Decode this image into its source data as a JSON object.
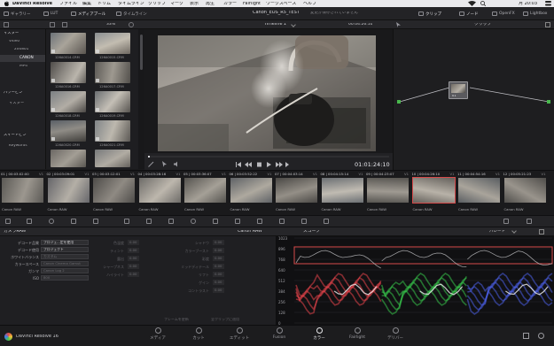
{
  "menubar": {
    "app": "DaVinci Resolve",
    "items": [
      "ファイル",
      "編集",
      "トリム",
      "タイムライン",
      "クリップ",
      "マーク",
      "表示",
      "再生",
      "カラー",
      "Fairlight",
      "ワークスペース",
      "ヘルプ"
    ],
    "clock": "月 20:03"
  },
  "toolbar": {
    "gallery": "ギャラリー",
    "lut": "LUT",
    "media_pool": "メディアプール",
    "timelines": "タイムライン",
    "project_title": "Canon_EOS_R5_TEST",
    "project_status": "変更が保存されていません",
    "clips": "クリップ",
    "nodes": "ノード",
    "openfx": "OpenFX",
    "lightbox": "Lightbox"
  },
  "media_pool": {
    "zoom": "33%",
    "bins": [
      {
        "label": "マスター",
        "selected": false
      },
      {
        "label": "Video",
        "selected": false
      },
      {
        "label": "200801",
        "selected": false
      },
      {
        "label": "CANON",
        "selected": true
      },
      {
        "label": "MP4",
        "selected": false
      }
    ],
    "power_bins_header": "パワービン",
    "power_bins": [
      "マスター"
    ],
    "smart_bins_header": "スマートビン",
    "smart_bins": [
      "Keywords"
    ],
    "clips": [
      "126A0014.CRM",
      "126A0015.CRM",
      "126A0016.CRM",
      "126A0017.CRM",
      "126A0018.CRM",
      "126A0019.CRM",
      "126A0020.CRM",
      "126A0021.CRM",
      "126A0022.CRM",
      "126A0023.CRM"
    ]
  },
  "viewer": {
    "timeline_name": "Timeline 1",
    "timecode": "01:01:24:10",
    "header_timecode": "00:04:26:10"
  },
  "node_editor": {
    "label": "クリップ",
    "node_label": "01"
  },
  "clip_strip": {
    "clips": [
      {
        "num": "01",
        "tc": "00:03:02:00",
        "track": "V1",
        "cap": "Canon RAW"
      },
      {
        "num": "02",
        "tc": "00:03:09:01",
        "track": "V1",
        "cap": "Canon RAW"
      },
      {
        "num": "03",
        "tc": "00:03:12:01",
        "track": "V1",
        "cap": "Canon RAW"
      },
      {
        "num": "04",
        "tc": "00:03:28:16",
        "track": "V1",
        "cap": "Canon RAW"
      },
      {
        "num": "05",
        "tc": "00:03:36:07",
        "track": "V1",
        "cap": "Canon RAW"
      },
      {
        "num": "06",
        "tc": "00:03:52:22",
        "track": "V1",
        "cap": "Canon RAW"
      },
      {
        "num": "07",
        "tc": "00:04:03:14",
        "track": "V1",
        "cap": "Canon RAW"
      },
      {
        "num": "08",
        "tc": "00:04:15:14",
        "track": "V1",
        "cap": "Canon RAW"
      },
      {
        "num": "09",
        "tc": "00:04:23:07",
        "track": "V1",
        "cap": "Canon RAW"
      },
      {
        "num": "10",
        "tc": "00:04:26:10",
        "track": "V1",
        "cap": "Canon RAW"
      },
      {
        "num": "11",
        "tc": "00:04:54:16",
        "track": "V1",
        "cap": "Canon RAW"
      },
      {
        "num": "12",
        "tc": "00:05:21:23",
        "track": "V1",
        "cap": "Canon RAW"
      }
    ]
  },
  "camera_raw": {
    "title": "カメラRAW",
    "format": "Canon RAW",
    "rows": [
      {
        "label": "デコード品質",
        "value": "プロジェ...定を使用"
      },
      {
        "label": "デコード使用",
        "value": "プロジェクト"
      },
      {
        "label": "ホワイトバランス",
        "value": "カスタム"
      },
      {
        "label": "カラースペース",
        "value": "Canon Cinema Gamut"
      },
      {
        "label": "ガンマ",
        "value": "Canon Log 2"
      },
      {
        "label": "ISO",
        "value": "800"
      }
    ],
    "mid_labels": [
      "色温度",
      "ティント",
      "露出",
      "シャープネス",
      "ハイライト"
    ],
    "mid_values": [
      "0.00",
      "0.00",
      "0.00",
      "0.00",
      "0.00"
    ],
    "right_labels": [
      "シャドウ",
      "カラーブースト",
      "彩度",
      "ミッドディテール",
      "リフト",
      "ゲイン",
      "コントラスト"
    ],
    "right_values": [
      "0.00",
      "0.00",
      "0.00",
      "0.00",
      "0.00",
      "0.00",
      "0.00"
    ],
    "btn_update": "フレームを更新",
    "btn_apply": "全クリップに適用"
  },
  "scope": {
    "title": "スコープ",
    "mode": "パレード",
    "scale": [
      "1023",
      "896",
      "768",
      "640",
      "512",
      "384",
      "256",
      "128",
      "0"
    ]
  },
  "pages": [
    {
      "label": "メディア",
      "active": false
    },
    {
      "label": "カット",
      "active": false
    },
    {
      "label": "エディット",
      "active": false
    },
    {
      "label": "Fusion",
      "active": false
    },
    {
      "label": "カラー",
      "active": true
    },
    {
      "label": "Fairlight",
      "active": false
    },
    {
      "label": "デリバー",
      "active": false
    }
  ],
  "footer": {
    "app_version": "DaVinci Resolve 16"
  },
  "colors": {
    "accent": "#d64a4a",
    "scope_red": "#e8434a",
    "scope_green": "#36c44a",
    "scope_blue": "#4b5fe6"
  }
}
